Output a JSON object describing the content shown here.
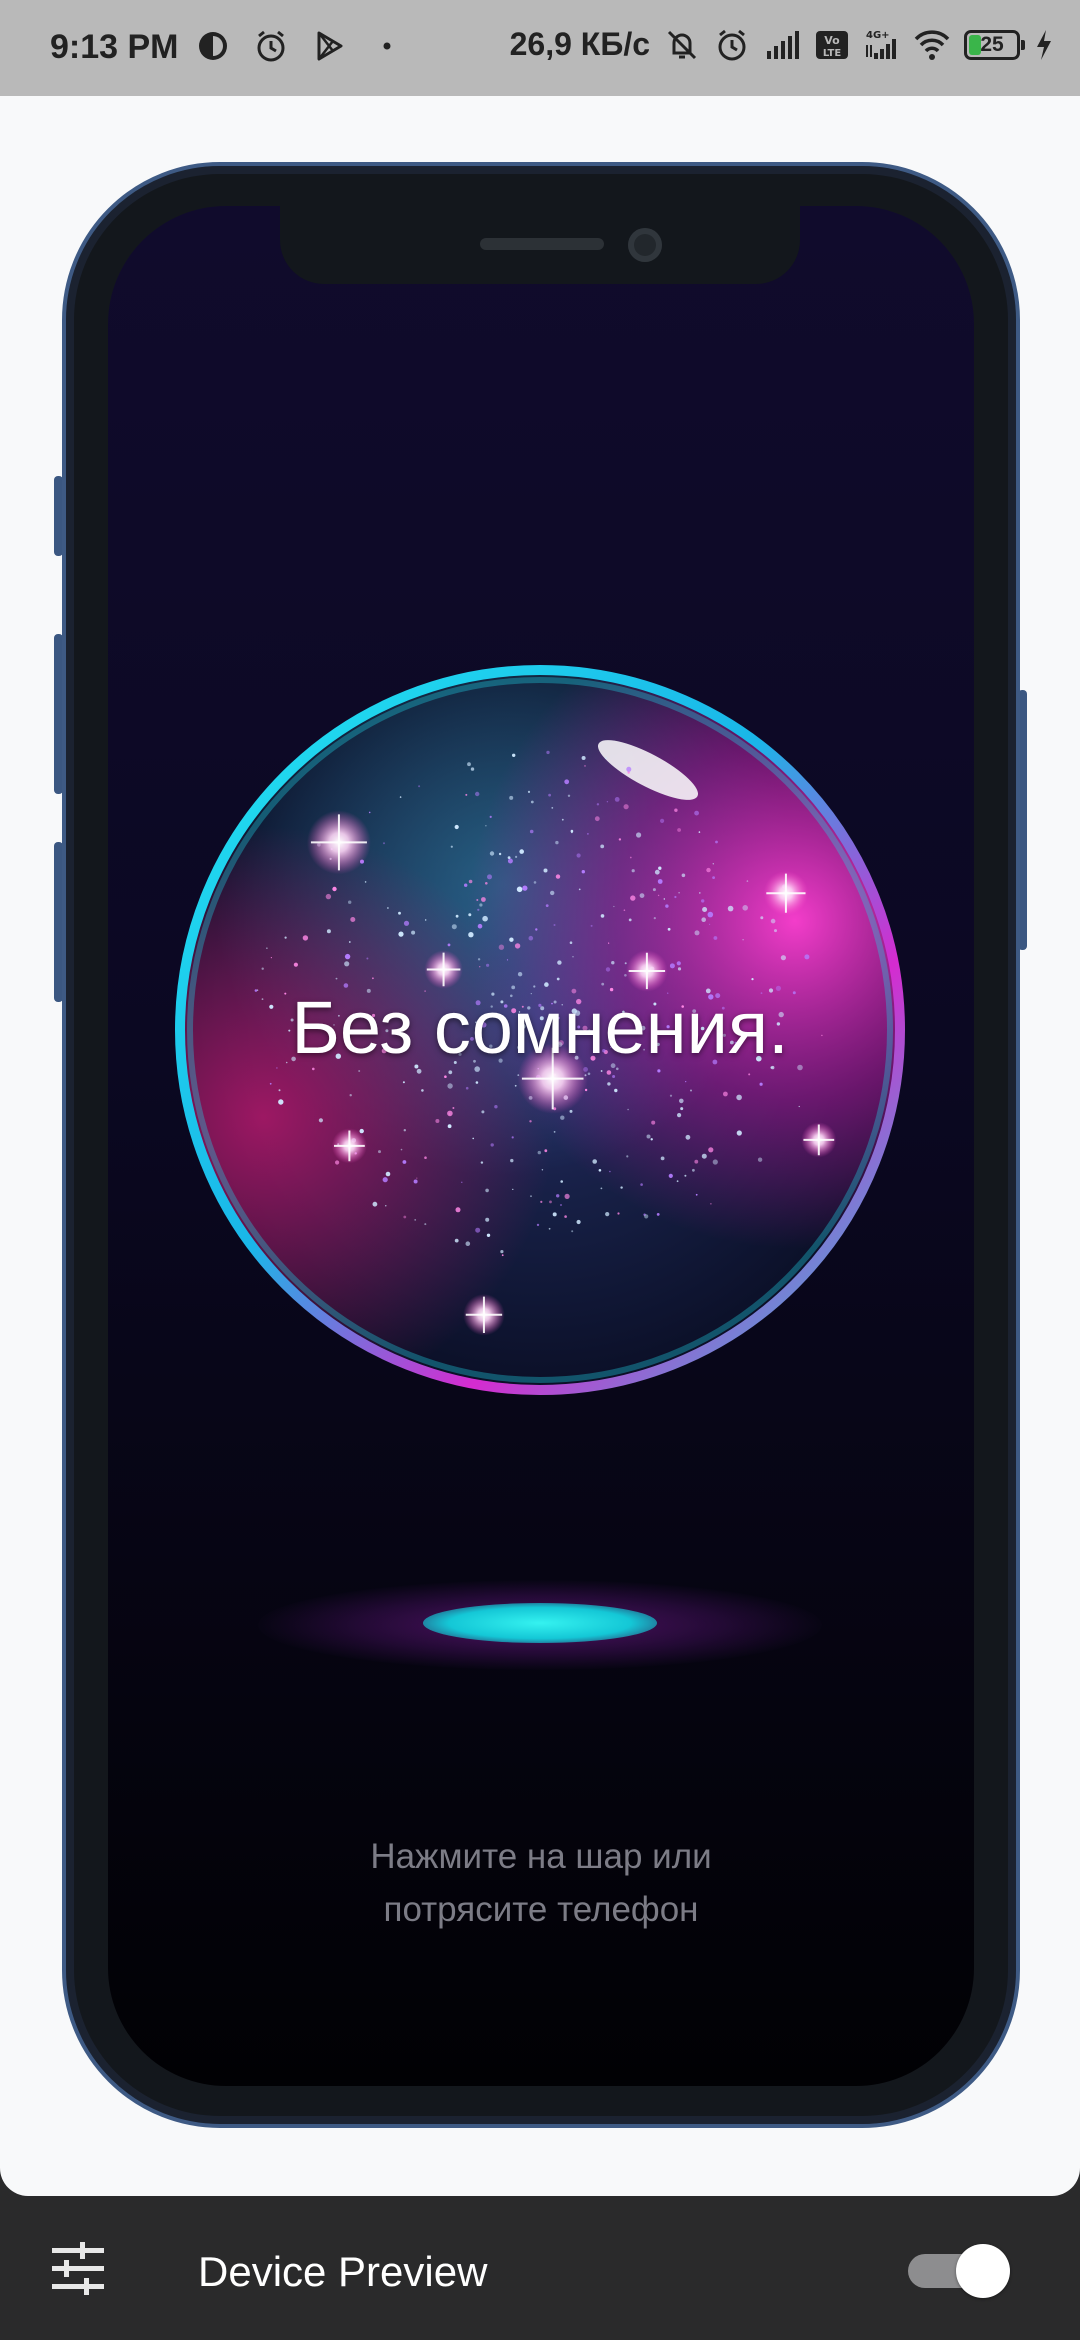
{
  "status_bar": {
    "time": "9:13 PM",
    "network_speed": "26,9 КБ/с",
    "battery_level": "25",
    "icons": [
      "data-saver-icon",
      "alarm-icon",
      "play-store-icon",
      "dot-icon",
      "bell-off-icon",
      "alarm-icon",
      "signal-icon",
      "volte-icon",
      "4g-signal-icon",
      "wifi-icon",
      "battery-icon",
      "charging-icon"
    ]
  },
  "device_preview": {
    "answer_text": "Без сомнения.",
    "hint_line1": "Нажмите на шар или",
    "hint_line2": "потрясите телефон"
  },
  "toolbar": {
    "title": "Device Preview",
    "settings_icon": "tune-icon",
    "toggle_on": true
  },
  "colors": {
    "screen_bg": "#0b0822",
    "ball_rim": "#19d8e8",
    "ball_pink": "#e02bb4",
    "frame": "#3e5a84"
  }
}
